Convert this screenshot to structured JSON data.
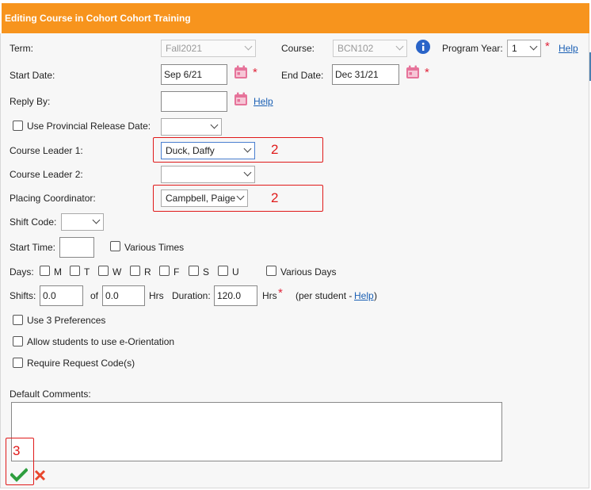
{
  "dialog": {
    "title": "Editing Course in Cohort Cohort Training"
  },
  "fields": {
    "term_label": "Term:",
    "term_value": "Fall2021",
    "course_label": "Course:",
    "course_value": "BCN102",
    "program_year_label": "Program Year:",
    "program_year_value": "1",
    "help_label": "Help",
    "start_date_label": "Start Date:",
    "start_date_value": "Sep 6/21",
    "end_date_label": "End Date:",
    "end_date_value": "Dec 31/21",
    "reply_by_label": "Reply By:",
    "reply_by_value": "",
    "use_release_date_label": "Use Provincial Release Date:",
    "course_leader1_label": "Course Leader 1:",
    "course_leader1_value": "Duck, Daffy",
    "course_leader2_label": "Course Leader 2:",
    "course_leader2_value": "",
    "placing_coord_label": "Placing Coordinator:",
    "placing_coord_value": "Campbell, Paige",
    "shift_code_label": "Shift Code:",
    "start_time_label": "Start Time:",
    "various_times_label": "Various Times",
    "days_label": "Days:",
    "days": [
      "M",
      "T",
      "W",
      "R",
      "F",
      "S",
      "U"
    ],
    "various_days_label": "Various Days",
    "shifts_label": "Shifts:",
    "shifts_value": "0.0",
    "of_label": "of",
    "of_value": "0.0",
    "hrs_label": "Hrs",
    "duration_label": "Duration:",
    "duration_value": "120.0",
    "hrs2_label": "Hrs",
    "per_student_prefix": "(per student -",
    "per_student_help": "Help",
    "per_student_suffix": ")",
    "use3_label": "Use 3 Preferences",
    "e_orientation_label": "Allow students to use e-Orientation",
    "request_code_label": "Require Request Code(s)",
    "default_comments_label": "Default Comments:",
    "required_mark": "*"
  },
  "annotations": {
    "a1": "2",
    "a2": "2",
    "a3": "3"
  },
  "colors": {
    "title_bar": "#f7941d",
    "annotation": "#e01a1a",
    "save_icon": "#2e9e3e",
    "cancel_icon": "#e8472d"
  },
  "icons": {
    "info": "info-icon",
    "calendar": "calendar-icon",
    "save": "checkmark-icon",
    "cancel": "x-icon"
  }
}
